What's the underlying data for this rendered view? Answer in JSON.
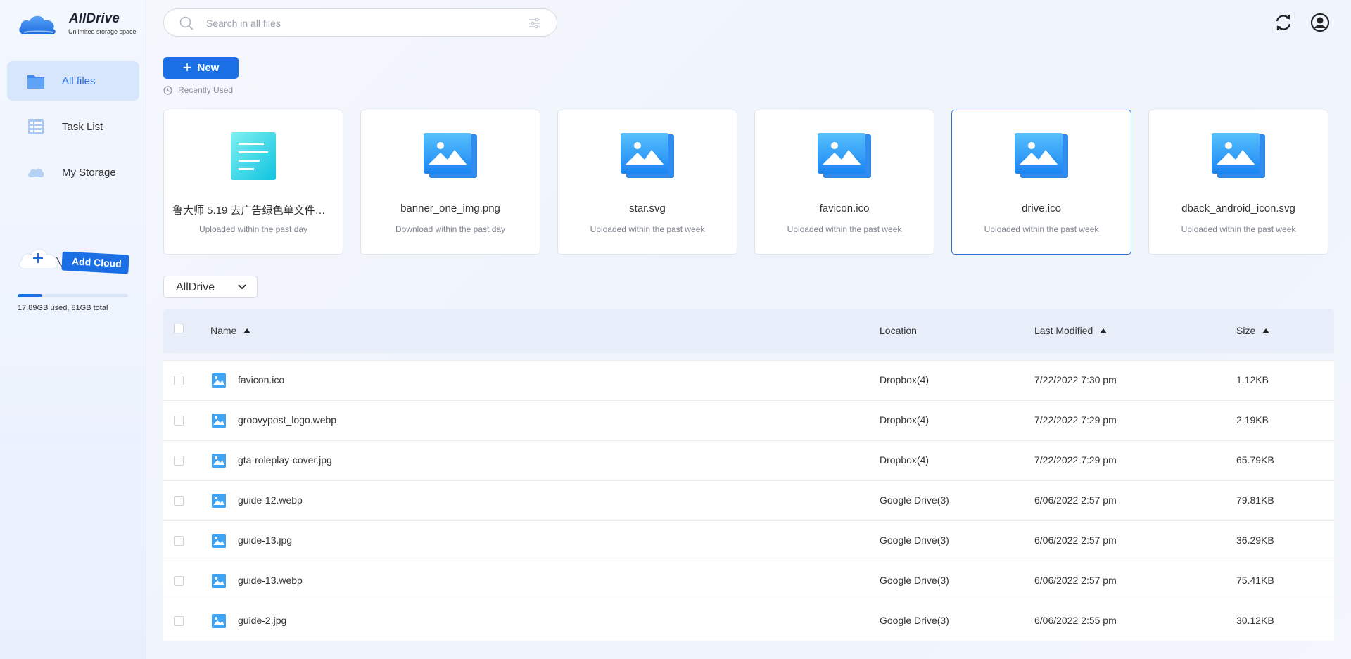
{
  "brand": {
    "name": "AllDrive",
    "tagline": "Unlimited storage space"
  },
  "sidebar": {
    "items": [
      {
        "label": "All files",
        "icon": "folder-icon",
        "active": true
      },
      {
        "label": "Task List",
        "icon": "task-list-icon",
        "active": false
      },
      {
        "label": "My Storage",
        "icon": "cloud-icon",
        "active": false
      }
    ],
    "add_cloud_label": "Add Cloud",
    "storage": {
      "used_fraction": 0.22,
      "text": "17.89GB used, 81GB total"
    }
  },
  "search": {
    "placeholder": "Search in all files",
    "value": ""
  },
  "toolbar": {
    "new_label": "New",
    "recent_label": "Recently Used"
  },
  "recent": [
    {
      "name": "鲁大师 5.19 去广告绿色单文件版....",
      "status": "Uploaded within the past day",
      "icon": "document-icon",
      "selected": false
    },
    {
      "name": "banner_one_img.png",
      "status": "Download within the past day",
      "icon": "image-icon",
      "selected": false
    },
    {
      "name": "star.svg",
      "status": "Uploaded within the past week",
      "icon": "image-icon",
      "selected": false
    },
    {
      "name": "favicon.ico",
      "status": "Uploaded within the past week",
      "icon": "image-icon",
      "selected": false
    },
    {
      "name": "drive.ico",
      "status": "Uploaded within the past week",
      "icon": "image-icon",
      "selected": true
    },
    {
      "name": "dback_android_icon.svg",
      "status": "Uploaded within the past week",
      "icon": "image-icon",
      "selected": false
    }
  ],
  "drive_filter": {
    "selected": "AllDrive"
  },
  "table": {
    "headers": {
      "name": "Name",
      "location": "Location",
      "modified": "Last Modified",
      "size": "Size"
    },
    "rows": [
      {
        "name": "favicon.ico",
        "location": "Dropbox(4)",
        "modified": "7/22/2022 7:30 pm",
        "size": "1.12KB"
      },
      {
        "name": "groovypost_logo.webp",
        "location": "Dropbox(4)",
        "modified": "7/22/2022 7:29 pm",
        "size": "2.19KB"
      },
      {
        "name": "gta-roleplay-cover.jpg",
        "location": "Dropbox(4)",
        "modified": "7/22/2022 7:29 pm",
        "size": "65.79KB"
      },
      {
        "name": "guide-12.webp",
        "location": "Google Drive(3)",
        "modified": "6/06/2022 2:57 pm",
        "size": "79.81KB"
      },
      {
        "name": "guide-13.jpg",
        "location": "Google Drive(3)",
        "modified": "6/06/2022 2:57 pm",
        "size": "36.29KB"
      },
      {
        "name": "guide-13.webp",
        "location": "Google Drive(3)",
        "modified": "6/06/2022 2:57 pm",
        "size": "75.41KB"
      },
      {
        "name": "guide-2.jpg",
        "location": "Google Drive(3)",
        "modified": "6/06/2022 2:55 pm",
        "size": "30.12KB"
      }
    ]
  },
  "colors": {
    "accent": "#1b6fe5",
    "active_nav_bg": "#d7e6fb",
    "table_header_bg": "#e7eefa"
  }
}
